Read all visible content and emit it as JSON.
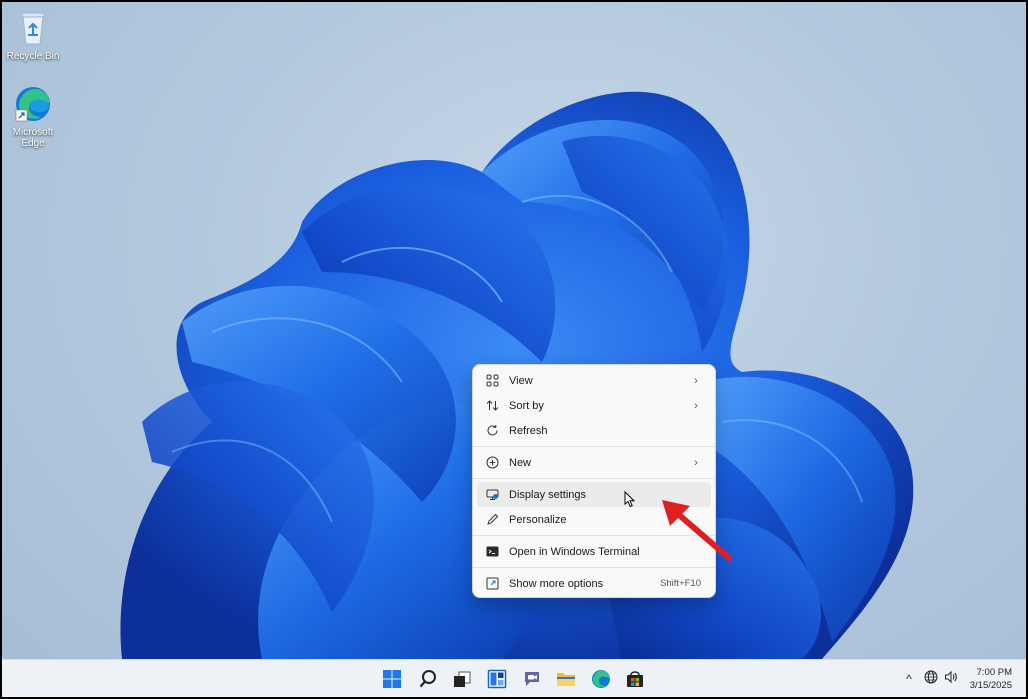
{
  "desktop": {
    "icons": [
      {
        "label": "Recycle Bin",
        "icon": "recycle-bin-icon"
      },
      {
        "label": "Microsoft Edge",
        "icon": "edge-icon"
      }
    ]
  },
  "context_menu": {
    "items": [
      {
        "label": "View",
        "icon": "view-grid-icon",
        "submenu": true
      },
      {
        "label": "Sort by",
        "icon": "sort-icon",
        "submenu": true
      },
      {
        "label": "Refresh",
        "icon": "refresh-icon",
        "submenu": false
      },
      {
        "label": "New",
        "icon": "new-plus-icon",
        "submenu": true
      },
      {
        "label": "Display settings",
        "icon": "display-settings-icon",
        "submenu": false,
        "hovered": true
      },
      {
        "label": "Personalize",
        "icon": "personalize-pen-icon",
        "submenu": false
      },
      {
        "label": "Open in Windows Terminal",
        "icon": "terminal-icon",
        "submenu": false
      },
      {
        "label": "Show more options",
        "icon": "more-options-icon",
        "submenu": false,
        "accelerator": "Shift+F10"
      }
    ],
    "chevron": "›"
  },
  "annotation": {
    "icon": "red-arrow-icon",
    "color": "#e02020"
  },
  "taskbar": {
    "apps": [
      "start-icon",
      "search-icon",
      "task-view-icon",
      "widgets-icon",
      "teams-chat-icon",
      "file-explorer-icon",
      "edge-icon",
      "store-icon"
    ],
    "tray": {
      "chevron": "^",
      "time": "7:00 PM",
      "date": "3/15/2025"
    }
  },
  "colors": {
    "accent_blue": "#1e5fd6",
    "menu_bg": "#f9f9f9",
    "taskbar_bg": "#eef2f7"
  }
}
